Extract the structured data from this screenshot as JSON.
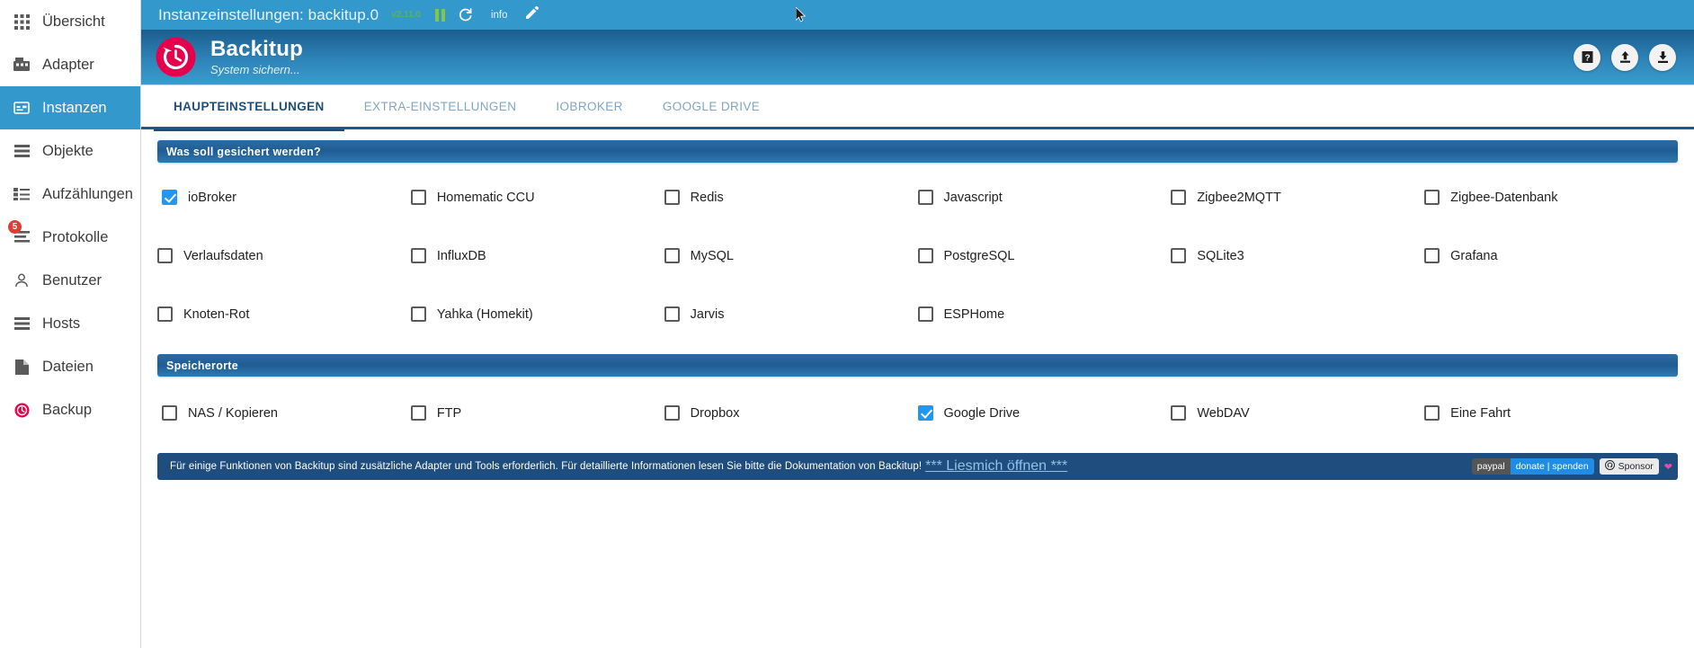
{
  "sidebar": {
    "items": [
      {
        "label": "Übersicht",
        "icon": "grid-icon",
        "active": false,
        "badge": null
      },
      {
        "label": "Adapter",
        "icon": "adapter-icon",
        "active": false,
        "badge": null
      },
      {
        "label": "Instanzen",
        "icon": "instances-icon",
        "active": true,
        "badge": null
      },
      {
        "label": "Objekte",
        "icon": "objects-icon",
        "active": false,
        "badge": null
      },
      {
        "label": "Aufzählungen",
        "icon": "enums-icon",
        "active": false,
        "badge": null
      },
      {
        "label": "Protokolle",
        "icon": "logs-icon",
        "active": false,
        "badge": "5"
      },
      {
        "label": "Benutzer",
        "icon": "user-icon",
        "active": false,
        "badge": null
      },
      {
        "label": "Hosts",
        "icon": "hosts-icon",
        "active": false,
        "badge": null
      },
      {
        "label": "Dateien",
        "icon": "files-icon",
        "active": false,
        "badge": null
      },
      {
        "label": "Backup",
        "icon": "backup-clock-icon",
        "active": false,
        "badge": null
      }
    ]
  },
  "topbar": {
    "title": "Instanzeinstellungen: backitup.0",
    "version": "v2.11.0",
    "info_label": "info",
    "pause_icon": "pause-icon",
    "refresh_icon": "refresh-icon",
    "edit_icon": "pencil-icon",
    "bg_color": "#3399cc",
    "version_color": "#57b15f"
  },
  "brand": {
    "title": "Backitup",
    "subtitle": "System sichern...",
    "logo_icon": "backup-clock-logo",
    "logo_color": "#e6004c",
    "actions": [
      {
        "name": "help-button",
        "icon": "question-mark-icon"
      },
      {
        "name": "upload-button",
        "icon": "upload-arrow-icon"
      },
      {
        "name": "download-button",
        "icon": "download-arrow-icon"
      }
    ]
  },
  "tabs": [
    {
      "label": "HAUPTEINSTELLUNGEN",
      "active": true
    },
    {
      "label": "EXTRA-EINSTELLUNGEN",
      "active": false
    },
    {
      "label": "IOBROKER",
      "active": false
    },
    {
      "label": "GOOGLE DRIVE",
      "active": false
    }
  ],
  "sections": [
    {
      "title": "Was soll gesichert werden?",
      "name": "backup-sources-section",
      "options": [
        {
          "label": "ioBroker",
          "checked": true
        },
        {
          "label": "Homematic CCU",
          "checked": false
        },
        {
          "label": "Redis",
          "checked": false
        },
        {
          "label": "Javascript",
          "checked": false
        },
        {
          "label": "Zigbee2MQTT",
          "checked": false
        },
        {
          "label": "Zigbee-Datenbank",
          "checked": false
        },
        {
          "label": "Verlaufsdaten",
          "checked": false
        },
        {
          "label": "InfluxDB",
          "checked": false
        },
        {
          "label": "MySQL",
          "checked": false
        },
        {
          "label": "PostgreSQL",
          "checked": false
        },
        {
          "label": "SQLite3",
          "checked": false
        },
        {
          "label": "Grafana",
          "checked": false
        },
        {
          "label": "Knoten-Rot",
          "checked": false
        },
        {
          "label": "Yahka (Homekit)",
          "checked": false
        },
        {
          "label": "Jarvis",
          "checked": false
        },
        {
          "label": "ESPHome",
          "checked": false
        }
      ]
    },
    {
      "title": "Speicherorte",
      "name": "storage-locations-section",
      "options": [
        {
          "label": "NAS / Kopieren",
          "checked": false
        },
        {
          "label": "FTP",
          "checked": false
        },
        {
          "label": "Dropbox",
          "checked": false
        },
        {
          "label": "Google Drive",
          "checked": true
        },
        {
          "label": "WebDAV",
          "checked": false
        },
        {
          "label": "Eine Fahrt",
          "checked": false
        }
      ]
    }
  ],
  "notice": {
    "text": "Für einige Funktionen von Backitup sind zusätzliche Adapter und Tools erforderlich. Für detaillierte Informationen lesen Sie bitte die Dokumentation von Backitup!",
    "link_text": "*** Liesmich öffnen ***",
    "bg_color": "#1f4d7d",
    "badges": {
      "paypal_left": "paypal",
      "paypal_right": "donate | spenden",
      "sponsor_label": "Sponsor",
      "sponsor_icon": "github-icon",
      "heart_icon": "heart-icon"
    }
  }
}
